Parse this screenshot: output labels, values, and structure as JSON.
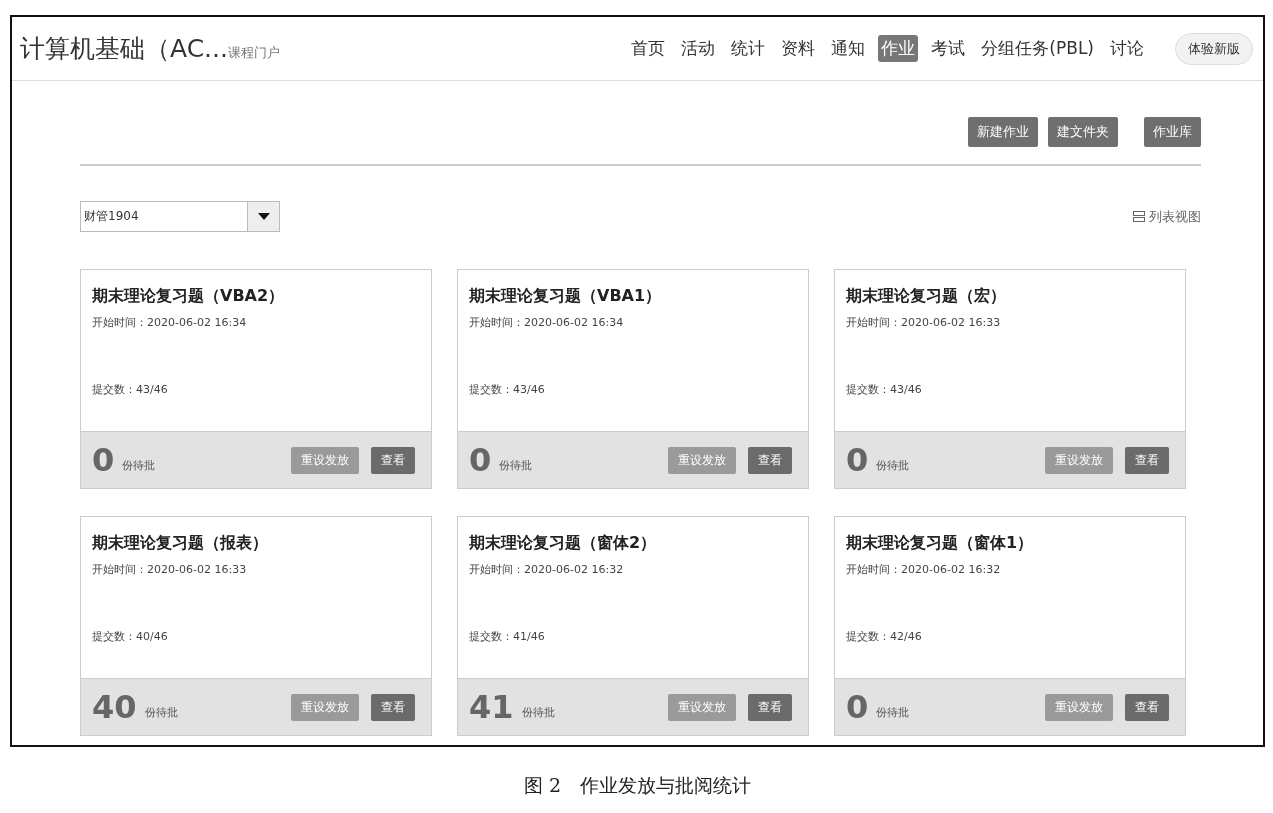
{
  "header": {
    "title": "计算机基础（AC...",
    "subtitle": "课程门户",
    "nav": [
      {
        "label": "首页",
        "selected": false
      },
      {
        "label": "活动",
        "selected": false
      },
      {
        "label": "统计",
        "selected": false
      },
      {
        "label": "资料",
        "selected": false
      },
      {
        "label": "通知",
        "selected": false
      },
      {
        "label": "作业",
        "selected": true
      },
      {
        "label": "考试",
        "selected": false
      },
      {
        "label": "分组任务(PBL)",
        "selected": false
      },
      {
        "label": "讨论",
        "selected": false
      }
    ],
    "new_version_button": "体验新版"
  },
  "actions": [
    "新建作业",
    "建文件夹",
    "作业库"
  ],
  "class_select": {
    "value": "财管1904"
  },
  "view_toggle": "列表视图",
  "cards": [
    {
      "title": "期末理论复习题（VBA2）",
      "start": "开始时间：2020-06-02 16:34",
      "submitted": "提交数：43/46",
      "pending": "0",
      "pending_label": "份待批",
      "reset_button": "重设发放",
      "view_button": "查看"
    },
    {
      "title": "期末理论复习题（VBA1）",
      "start": "开始时间：2020-06-02 16:34",
      "submitted": "提交数：43/46",
      "pending": "0",
      "pending_label": "份待批",
      "reset_button": "重设发放",
      "view_button": "查看"
    },
    {
      "title": "期末理论复习题（宏）",
      "start": "开始时间：2020-06-02 16:33",
      "submitted": "提交数：43/46",
      "pending": "0",
      "pending_label": "份待批",
      "reset_button": "重设发放",
      "view_button": "查看"
    },
    {
      "title": "期末理论复习题（报表）",
      "start": "开始时间：2020-06-02 16:33",
      "submitted": "提交数：40/46",
      "pending": "40",
      "pending_label": "份待批",
      "reset_button": "重设发放",
      "view_button": "查看"
    },
    {
      "title": "期末理论复习题（窗体2）",
      "start": "开始时间：2020-06-02 16:32",
      "submitted": "提交数：41/46",
      "pending": "41",
      "pending_label": "份待批",
      "reset_button": "重设发放",
      "view_button": "查看"
    },
    {
      "title": "期末理论复习题（窗体1）",
      "start": "开始时间：2020-06-02 16:32",
      "submitted": "提交数：42/46",
      "pending": "0",
      "pending_label": "份待批",
      "reset_button": "重设发放",
      "view_button": "查看"
    }
  ],
  "caption": "图 2　作业发放与批阅统计"
}
